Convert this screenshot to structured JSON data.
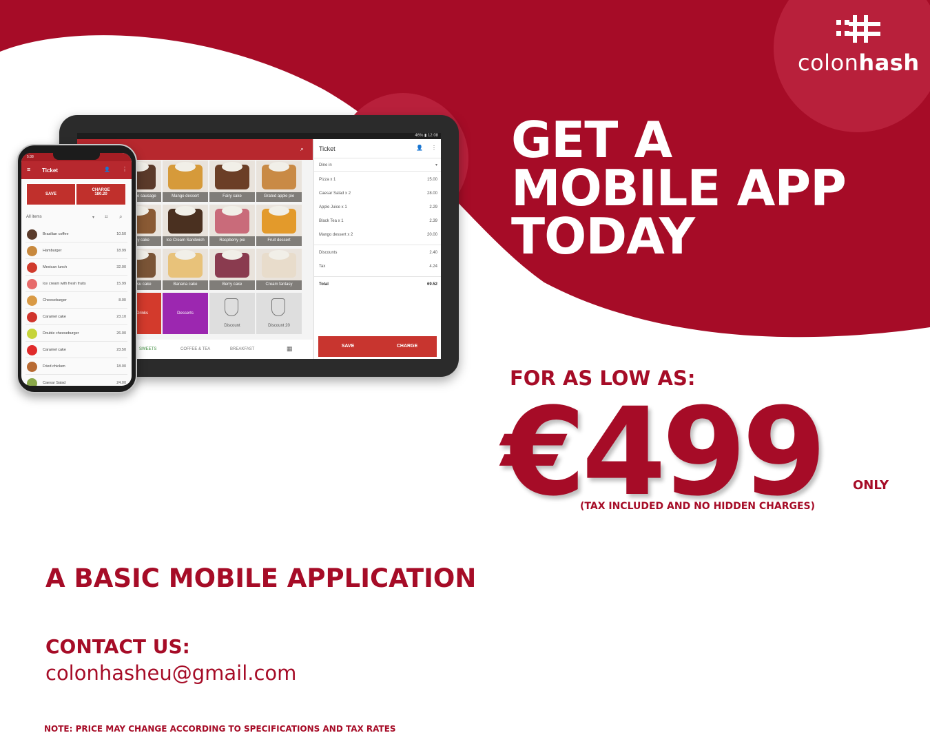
{
  "brand": {
    "logo_text_light": "colon",
    "logo_text_bold": "hash",
    "primary_color": "#a60c27",
    "secondary_color": "#b8203b"
  },
  "headline": {
    "line1": "GET A",
    "line2": "MOBILE APP",
    "line3": "TODAY"
  },
  "pricing": {
    "intro": "FOR AS LOW AS:",
    "price": "€499",
    "suffix": "ONLY",
    "note": "(TAX INCLUDED AND NO HIDDEN CHARGES)"
  },
  "product": "A BASIC MOBILE APPLICATION",
  "contact": {
    "label": "CONTACT US:",
    "email": "colonhasheu@gmail.com"
  },
  "disclaimer": "NOTE: PRICE MAY CHANGE ACCORDING TO SPECIFICATIONS AND TAX RATES",
  "tablet": {
    "status_time": "46% ▮ 12:08",
    "tiles": [
      {
        "label": "Chocolate sausage",
        "color": "#5b3a2a"
      },
      {
        "label": "Mango dessert",
        "color": "#d69a3a"
      },
      {
        "label": "Fairy cake",
        "color": "#6b3e26"
      },
      {
        "label": "Grated apple pie",
        "color": "#c98a45"
      },
      {
        "label": "Honey cake",
        "color": "#8a5a34"
      },
      {
        "label": "Ice Cream Sandwich",
        "color": "#4a3020"
      },
      {
        "label": "Raspberry pie",
        "color": "#c96b7a"
      },
      {
        "label": "Fruit dessert",
        "color": "#e39a2b"
      },
      {
        "label": "Tiramisu cake",
        "color": "#7a5436"
      },
      {
        "label": "Banana cake",
        "color": "#e8c27a"
      },
      {
        "label": "Berry cake",
        "color": "#8a3b4f"
      },
      {
        "label": "Cream fantasy",
        "color": "#e8dccb"
      },
      {
        "label": "Hot Drinks",
        "color": "#d33a2c"
      },
      {
        "label": "Desserts",
        "color": "#9c27b0"
      },
      {
        "label": "Discount",
        "color": "#dedede"
      },
      {
        "label": "Discount 20",
        "color": "#dedede"
      }
    ],
    "tabs": [
      "SWEETS",
      "COFFEE & TEA",
      "BREAKFAST"
    ],
    "ticket": {
      "title": "Ticket",
      "dining": "Dine in",
      "items": [
        {
          "name": "Pizza x 1",
          "value": "15.00"
        },
        {
          "name": "Caesar Salad x 2",
          "value": "28.00"
        },
        {
          "name": "Apple Juice x 1",
          "value": "2.29"
        },
        {
          "name": "Black Tea x 1",
          "value": "2.39"
        },
        {
          "name": "Mango dessert x 2",
          "value": "20.00"
        }
      ],
      "discounts_label": "Discounts",
      "discounts_value": "2.40",
      "tax_label": "Tax",
      "tax_value": "4.24",
      "total_label": "Total",
      "total_value": "69.52",
      "save_label": "SAVE",
      "charge_label": "CHARGE"
    }
  },
  "phone": {
    "status_time": "5:38",
    "title": "Ticket",
    "save_label": "SAVE",
    "charge_label": "CHARGE",
    "charge_amount": "180.20",
    "filter": "All items",
    "items": [
      {
        "name": "Brasilian coffee",
        "value": "10.50",
        "color": "#5a3b2b"
      },
      {
        "name": "Hamburger",
        "value": "18.99",
        "color": "#c8893e"
      },
      {
        "name": "Mexican lunch",
        "value": "32.00",
        "color": "#d03a2c"
      },
      {
        "name": "Ice cream with fresh fruits",
        "value": "15.99",
        "color": "#e76b6b"
      },
      {
        "name": "Cheeseburger",
        "value": "8.00",
        "color": "#d99a45"
      },
      {
        "name": "Caramel cake",
        "value": "23.10",
        "color": "#d0342c"
      },
      {
        "name": "Double cheeseburger",
        "value": "26.00",
        "color": "#c6d43a"
      },
      {
        "name": "Caramel cake",
        "value": "23.50",
        "color": "#e02a2a"
      },
      {
        "name": "Fried chicken",
        "value": "18.00",
        "color": "#b86a32"
      },
      {
        "name": "Caesar Salad",
        "value": "24.00",
        "color": "#8aa84a"
      }
    ]
  }
}
